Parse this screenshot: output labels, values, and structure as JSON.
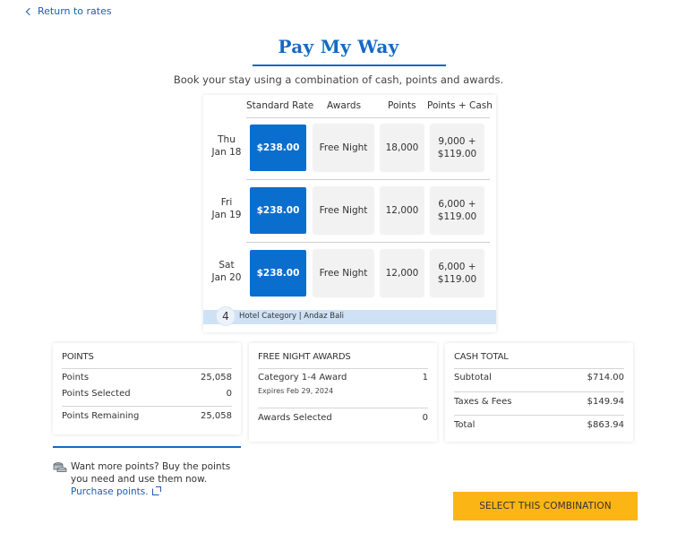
{
  "nav": {
    "back_label": "Return to rates",
    "back_icon": "chevron-left-icon"
  },
  "header": {
    "title": "Pay My Way",
    "subtitle": "Book your stay using a combination of cash, points and awards."
  },
  "rate_grid": {
    "columns": [
      "Standard Rate",
      "Awards",
      "Points",
      "Points + Cash"
    ],
    "rows": [
      {
        "day": "Thu",
        "date": "Jan 18",
        "standard_rate": "$238.00",
        "awards": "Free Night",
        "points": "18,000",
        "points_cash_pts": "9,000 +",
        "points_cash_cash": "$119.00",
        "selected": "standard_rate"
      },
      {
        "day": "Fri",
        "date": "Jan 19",
        "standard_rate": "$238.00",
        "awards": "Free Night",
        "points": "12,000",
        "points_cash_pts": "6,000 +",
        "points_cash_cash": "$119.00",
        "selected": "standard_rate"
      },
      {
        "day": "Sat",
        "date": "Jan 20",
        "standard_rate": "$238.00",
        "awards": "Free Night",
        "points": "12,000",
        "points_cash_pts": "6,000 +",
        "points_cash_cash": "$119.00",
        "selected": "standard_rate"
      }
    ],
    "category": {
      "number": "4",
      "label": "Hotel Category | Andaz Bali"
    }
  },
  "points_panel": {
    "title": "POINTS",
    "points_label": "Points",
    "points_value": "25,058",
    "selected_label": "Points Selected",
    "selected_value": "0",
    "remaining_label": "Points Remaining",
    "remaining_value": "25,058"
  },
  "awards_panel": {
    "title": "FREE NIGHT AWARDS",
    "award_label": "Category 1-4 Award",
    "award_value": "1",
    "award_expiry": "Expires Feb 29, 2024",
    "selected_label": "Awards Selected",
    "selected_value": "0"
  },
  "cash_panel": {
    "title": "CASH TOTAL",
    "subtotal_label": "Subtotal",
    "subtotal_value": "$714.00",
    "taxes_label": "Taxes & Fees",
    "taxes_value": "$149.94",
    "total_label": "Total",
    "total_value": "$863.94"
  },
  "promo": {
    "text": "Want more points? Buy the points you need and use them now. ",
    "link_label": "Purchase points.",
    "icon": "coins-icon"
  },
  "actions": {
    "select_label": "SELECT THIS COMBINATION"
  },
  "colors": {
    "accent_blue": "#0a6ecf",
    "button_yellow": "#fbb514",
    "category_bar": "#cfe1f5"
  }
}
